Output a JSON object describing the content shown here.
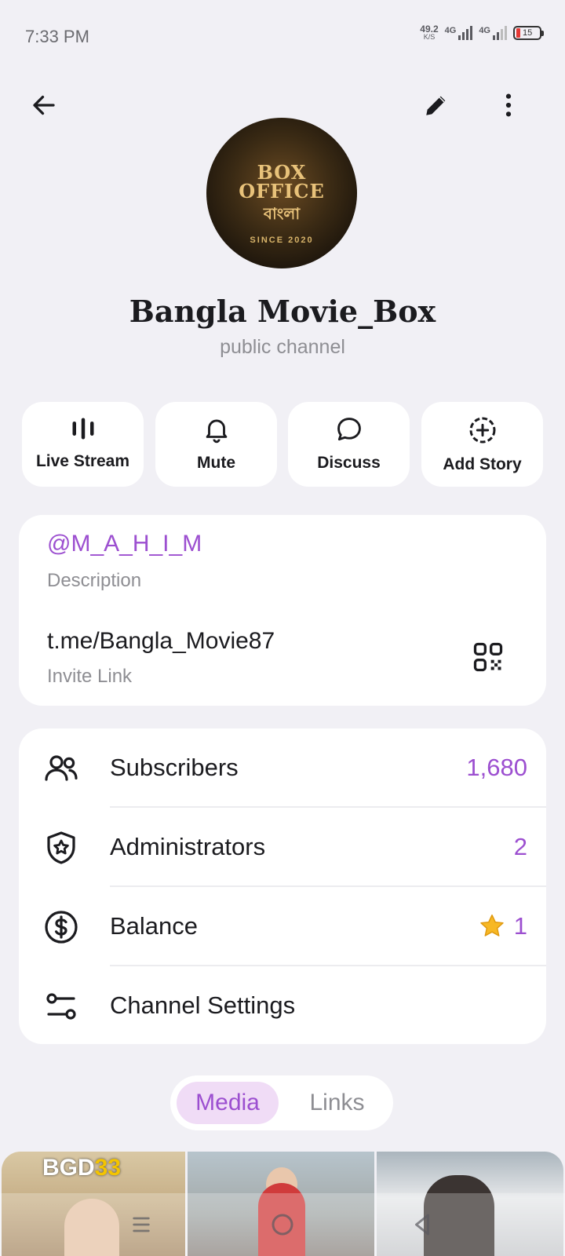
{
  "status": {
    "time": "7:33 PM",
    "net_speed": "49.2",
    "net_unit": "K/S",
    "signal1": "4G",
    "signal2": "4G",
    "battery": "15"
  },
  "header": {
    "back_icon": "arrow-left-icon",
    "edit_icon": "pencil-icon",
    "more_icon": "more-vertical-icon"
  },
  "avatar": {
    "line1": "BOX",
    "line2": "OFFICE",
    "line3": "বাংলা",
    "since": "SINCE 2020"
  },
  "channel": {
    "title": "Bangla Movie_Box",
    "subtitle": "public channel"
  },
  "actions": [
    {
      "label": "Live Stream",
      "icon": "live-stream-icon"
    },
    {
      "label": "Mute",
      "icon": "bell-icon"
    },
    {
      "label": "Discuss",
      "icon": "chat-bubble-icon"
    },
    {
      "label": "Add Story",
      "icon": "add-story-icon"
    }
  ],
  "info": {
    "username": "@M_A_H_I_M",
    "username_label": "Description",
    "link": "t.me/Bangla_Movie87",
    "link_label": "Invite Link",
    "qr_icon": "qr-code-icon"
  },
  "rows": [
    {
      "label": "Subscribers",
      "value": "1,680",
      "icon": "users-icon"
    },
    {
      "label": "Administrators",
      "value": "2",
      "icon": "shield-star-icon"
    },
    {
      "label": "Balance",
      "value": "1",
      "icon": "dollar-circle-icon"
    },
    {
      "label": "Channel Settings",
      "value": "",
      "icon": "sliders-icon"
    }
  ],
  "tabs": {
    "media": "Media",
    "links": "Links"
  },
  "media": {
    "thumb1_text_a": "BGD",
    "thumb1_text_b": "33"
  },
  "colors": {
    "accent": "#9c4fd0",
    "tab_active_bg": "#f0dcf6",
    "background": "#f1f0f5"
  }
}
